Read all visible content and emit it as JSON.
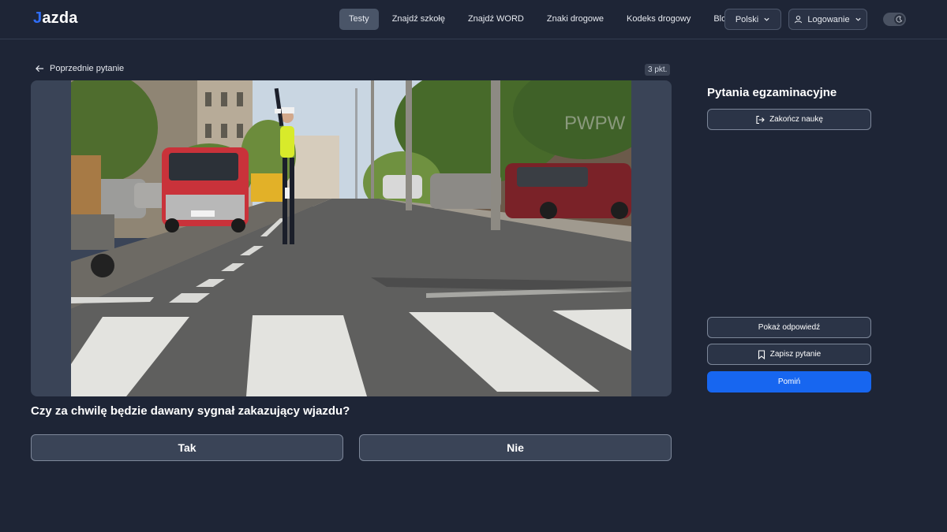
{
  "brand": {
    "prefix": "J",
    "rest": "azda"
  },
  "nav": {
    "items": [
      {
        "label": "Testy",
        "active": true
      },
      {
        "label": "Znajdź szkołę"
      },
      {
        "label": "Znajdź WORD"
      },
      {
        "label": "Znaki drogowe"
      },
      {
        "label": "Kodeks drogowy"
      },
      {
        "label": "Blog"
      }
    ],
    "language": "Polski",
    "login": "Logowanie"
  },
  "question": {
    "back_label": "Poprzednie pytanie",
    "points": "3 pkt.",
    "text": "Czy za chwilę będzie dawany sygnał zakazujący wjazdu?",
    "answers": [
      "Tak",
      "Nie"
    ],
    "photo_watermark": "PWPW"
  },
  "sidebar": {
    "title": "Pytania egzaminacyjne",
    "end_label": "Zakończ naukę",
    "show_label": "Pokaż odpowiedź",
    "save_label": "Zapisz pytanie",
    "skip_label": "Pomiń"
  },
  "colors": {
    "background": "#1e2536",
    "accent": "#1766f0",
    "panel": "#3a4457"
  },
  "icons": {
    "back": "arrow-left-icon",
    "user": "user-icon",
    "moon": "moon-icon",
    "logout": "logout-icon",
    "bookmark": "bookmark-icon",
    "chevron": "chevron-down-icon"
  }
}
